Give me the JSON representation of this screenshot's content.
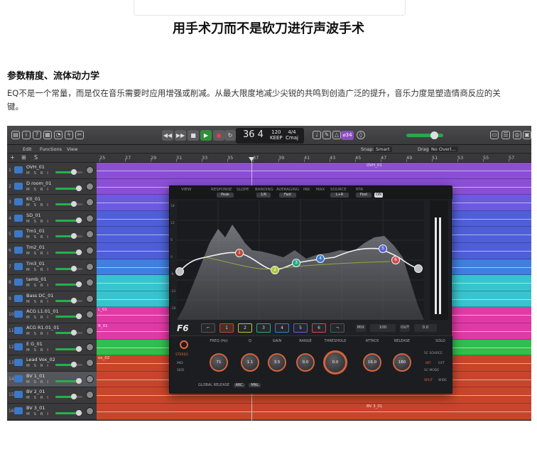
{
  "article": {
    "title": "用手术刀而不是砍刀进行声波手术",
    "subheading": "参数精度、流体动力学",
    "paragraph": "EQ不是一个常量，而是仅在音乐需要时应用增强或削减。从最大限度地减少尖锐的共鸣到创造广泛的提升，音乐力度是塑造情商反应的关键。"
  },
  "daw": {
    "lcd": {
      "bar": "36 4",
      "tempo": "120",
      "tempo_label": "KEEP",
      "signature": "4/4",
      "key": "Cmaj"
    },
    "badge": "⌀34",
    "menu": {
      "edit": "Edit",
      "functions": "Functions",
      "view": "View"
    },
    "snap": {
      "label": "Snap:",
      "value": "Smart",
      "drag_label": "Drag:",
      "drag_value": "No Overl..."
    },
    "ruler": [
      "25",
      "27",
      "29",
      "31",
      "33",
      "35",
      "37",
      "39",
      "41",
      "43",
      "45",
      "47",
      "49",
      "51",
      "53",
      "55",
      "57"
    ],
    "tracks": [
      {
        "num": "1",
        "name": "OVH_01",
        "color": "#8b4fd6",
        "region": "OVH_01"
      },
      {
        "num": "2",
        "name": "D room_01",
        "color": "#8b4fd6",
        "region": ""
      },
      {
        "num": "3",
        "name": "Kit_01",
        "color": "#6b5be0",
        "region": ""
      },
      {
        "num": "4",
        "name": "SD_01",
        "color": "#4f5fd8",
        "region": ""
      },
      {
        "num": "5",
        "name": "Tm1_01",
        "color": "#4f5fd8",
        "region": ""
      },
      {
        "num": "6",
        "name": "Tm2_01",
        "color": "#4f5fd8",
        "region": ""
      },
      {
        "num": "7",
        "name": "Tm3_01",
        "color": "#3e7fe0",
        "region": ""
      },
      {
        "num": "8",
        "name": "tamb_01",
        "color": "#37c4cf",
        "region": ""
      },
      {
        "num": "9",
        "name": "Bass DC_01",
        "color": "#37c4cf",
        "region": ""
      },
      {
        "num": "10",
        "name": "ACG L1.01_01",
        "color": "#e03aa6",
        "region": "L_01"
      },
      {
        "num": "11",
        "name": "ACG R1.01_01",
        "color": "#e03aa6",
        "region": "R_01"
      },
      {
        "num": "12",
        "name": "E G_01",
        "color": "#2fbf4a",
        "region": ""
      },
      {
        "num": "13",
        "name": "Lead Vox_02",
        "color": "#c8452c",
        "region": "ox_02"
      },
      {
        "num": "14",
        "name": "BV 1_01",
        "color": "#c8452c",
        "region": ""
      },
      {
        "num": "15",
        "name": "BV 2_01",
        "color": "#c8452c",
        "region": ""
      },
      {
        "num": "16",
        "name": "BV 3_01",
        "color": "#c8452c",
        "region": "BV 3_01"
      }
    ],
    "track_buttons": "M S R I"
  },
  "plugin": {
    "logo": "F6",
    "tabs": [
      "VIEW",
      "RESPONSE",
      "SLOPE",
      "BANDING",
      "AVERAGING",
      "INK",
      "MAX",
      "SOURCE",
      "RTA"
    ],
    "tab_values": {
      "response": "Peak",
      "banding": "1/6",
      "averaging": "Fast",
      "source": "L+R",
      "rta": "Post",
      "rta_state": "ON"
    },
    "db_scale": [
      "18",
      "12",
      "6",
      "0",
      "-6",
      "-12",
      "-18"
    ],
    "bands": [
      "1",
      "2",
      "3",
      "4",
      "5",
      "6"
    ],
    "mix": {
      "label": "MIX",
      "value": "100",
      "out_label": "OUT",
      "out_value": "0.0"
    },
    "control_labels": [
      "FREQ (Hz)",
      "Q",
      "GAIN",
      "RANGE",
      "THRESHOLD",
      "ATTACK",
      "RELEASE",
      "SOLO"
    ],
    "knob_values": [
      "71",
      "1.1",
      "3.5",
      "0.0",
      "0.0",
      "16.0",
      "180"
    ],
    "side": {
      "stereo": "STEREO",
      "mid": "MID",
      "side": "SIDE",
      "sc_source": "SC SOURCE",
      "int": "INT",
      "ext": "EXT",
      "sc_mode": "SC MODE",
      "split": "SPLIT",
      "wide": "WIDE"
    },
    "footer": {
      "label": "GLOBAL RELEASE",
      "a": "ARC",
      "b": "MNL"
    },
    "colors": {
      "accent": "#e06b3a",
      "band1": "#c0453a",
      "band2": "#b5c43a",
      "band3": "#2fa58a",
      "band4": "#3a7ad0",
      "band5": "#5a62d8",
      "band6": "#d04a4a"
    }
  }
}
